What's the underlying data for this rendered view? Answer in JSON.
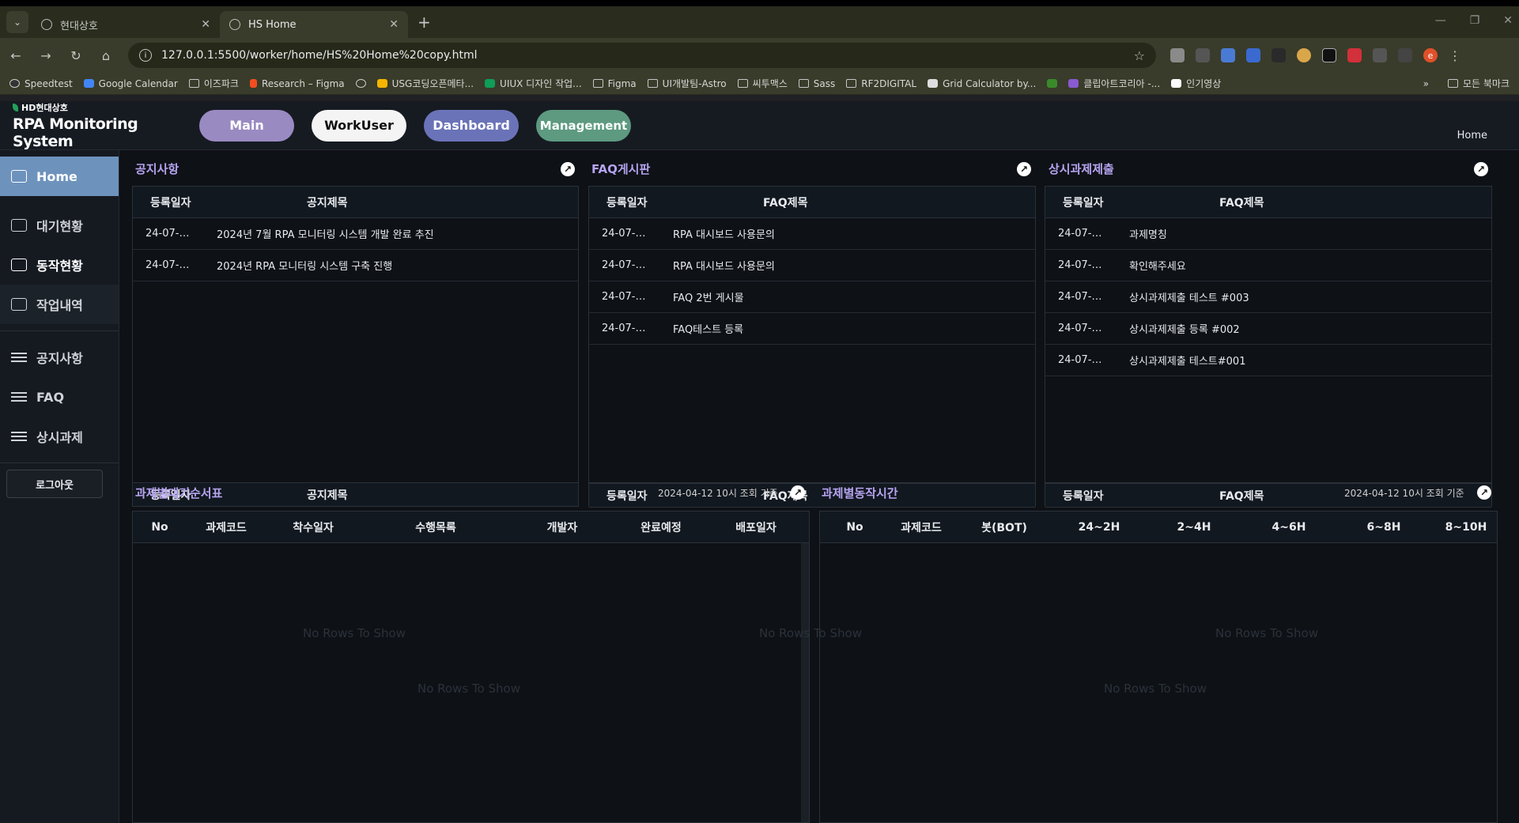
{
  "browser": {
    "tabs": [
      {
        "label": "현대상호",
        "active": false
      },
      {
        "label": "HS Home",
        "active": true
      }
    ],
    "url": "127.0.0.1:5500/worker/home/HS%20Home%20copy.html",
    "bookmarks": [
      "Speedtest",
      "Google Calendar",
      "이즈파크",
      "Research – Figma",
      "USG코딩오픈메타...",
      "UIUX 디자인 작업...",
      "Figma",
      "UI개발팀-Astro",
      "씨투맥스",
      "Sass",
      "RF2DIGITAL",
      "Grid Calculator by...",
      "클립아트코리아 -...",
      "인기영상"
    ],
    "bookmarks_more": "»",
    "all_bookmarks": "모든 북마크",
    "profile_initial": "e"
  },
  "app": {
    "brand_small": "HD현대상호",
    "brand_title": "RPA Monitoring System",
    "nav": {
      "main": "Main",
      "workuser": "WorkUser",
      "dashboard": "Dashboard",
      "management": "Management"
    },
    "breadcrumb": "Home",
    "sidebar": {
      "home": "Home",
      "waiting": "대기현황",
      "running": "동작현황",
      "history": "작업내역",
      "notice": "공지사항",
      "faq": "FAQ",
      "regular": "상시과제",
      "logout": "로그아웃"
    },
    "notice": {
      "title": "공지사항",
      "col_date": "등록일자",
      "col_title": "공지제목",
      "rows": [
        {
          "date": "24-07-…",
          "title": "2024년 7월 RPA 모니터링 시스템 개발 완료 추진"
        },
        {
          "date": "24-07-…",
          "title": "2024년 RPA 모니터링 시스템 구축 진행"
        }
      ]
    },
    "faq": {
      "title": "FAQ게시판",
      "col_date": "등록일자",
      "col_title": "FAQ제목",
      "rows": [
        {
          "date": "24-07-…",
          "title": "RPA 대시보드 사용문의"
        },
        {
          "date": "24-07-…",
          "title": "RPA 대시보드 사용문의"
        },
        {
          "date": "24-07-…",
          "title": "FAQ 2번 게시물"
        },
        {
          "date": "24-07-…",
          "title": "FAQ테스트 등록"
        }
      ]
    },
    "regular": {
      "title": "상시과제제출",
      "col_date": "등록일자",
      "col_title": "FAQ제목",
      "rows": [
        {
          "date": "24-07-…",
          "title": "과제명칭"
        },
        {
          "date": "24-07-…",
          "title": "확인해주세요"
        },
        {
          "date": "24-07-…",
          "title": "상시과제제출 테스트 #003"
        },
        {
          "date": "24-07-…",
          "title": "상시과제제출 등록 #002"
        },
        {
          "date": "24-07-…",
          "title": "상시과제제출 테스트#001"
        }
      ]
    },
    "lower_ghost": {
      "col_date": "등록일자",
      "col_notice_title": "공지제목",
      "col_faq_title": "FAQ제목"
    },
    "wait_order": {
      "title": "과제별대기순서표",
      "stamp": "2024-04-12 10시 조회 기준",
      "columns": [
        "No",
        "과제코드",
        "착수일자",
        "수행목록",
        "개발자",
        "완료예정",
        "배포일자"
      ],
      "empty": "No Rows To Show"
    },
    "run_time": {
      "title": "과제별동작시간",
      "stamp": "2024-04-12 10시 조회 기준",
      "columns": [
        "No",
        "과제코드",
        "봇(BOT)",
        "24~2H",
        "2~4H",
        "4~6H",
        "6~8H",
        "8~10H"
      ],
      "empty": "No Rows To Show"
    },
    "ghost_empty": "No Rows To Show"
  }
}
